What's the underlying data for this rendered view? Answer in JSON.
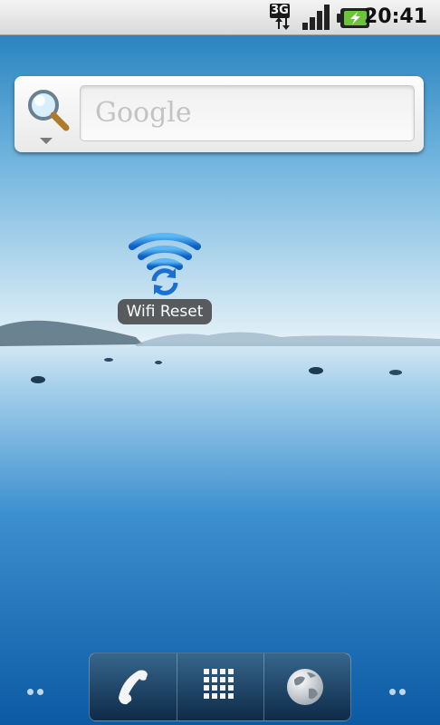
{
  "status_bar": {
    "network_type": "3G",
    "clock": "20:41",
    "icons": [
      "data-activity-icon",
      "signal-strength-icon",
      "battery-charging-icon"
    ]
  },
  "search_widget": {
    "placeholder": "Google",
    "icons": [
      "search-magnifier-icon",
      "search-source-dropdown-icon"
    ]
  },
  "home_screen": {
    "apps": [
      {
        "label": "Wifi Reset",
        "icon": "wifi-reset-icon"
      }
    ]
  },
  "dock": {
    "items": [
      {
        "name": "phone",
        "icon": "phone-handset-icon"
      },
      {
        "name": "launcher",
        "icon": "app-drawer-grid-icon"
      },
      {
        "name": "browser",
        "icon": "globe-icon"
      }
    ]
  },
  "colors": {
    "wifi_icon_blue": "#1a6fd1",
    "label_background": "#3c3c3c",
    "sky_top": "#1b78b8",
    "sea_bottom": "#0a57a0"
  }
}
